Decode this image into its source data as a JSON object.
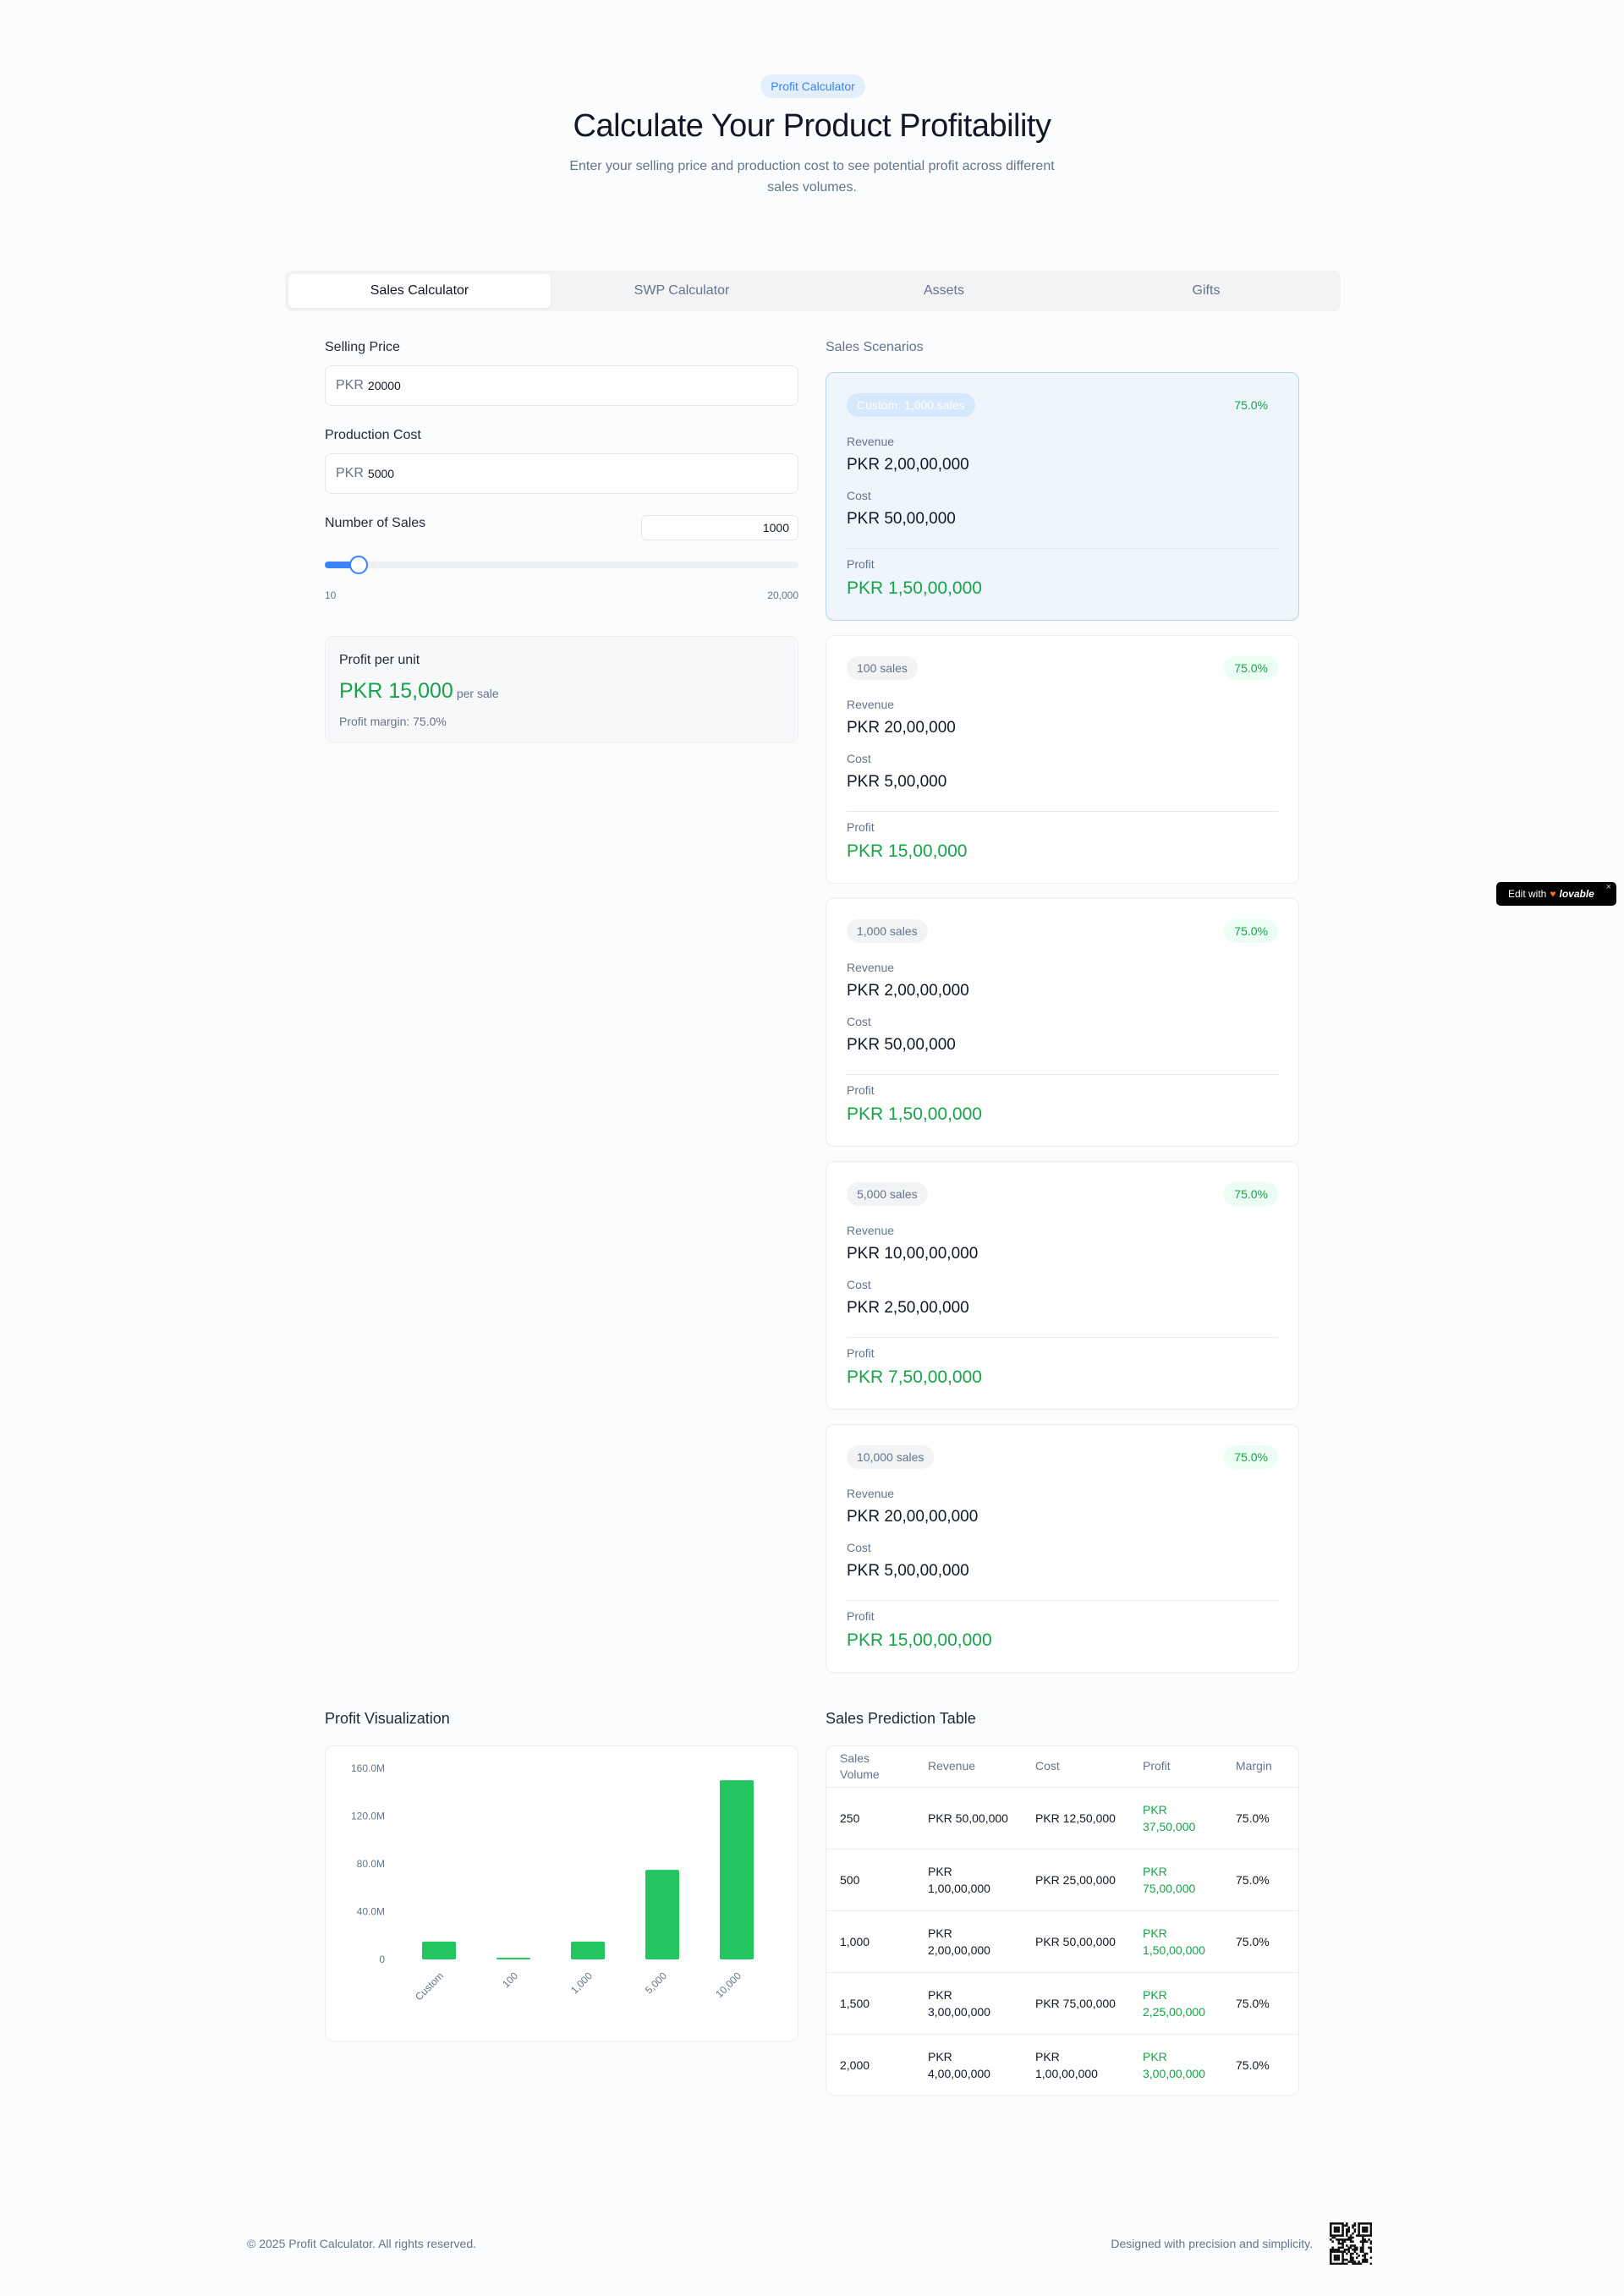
{
  "hero": {
    "badge": "Profit Calculator",
    "title": "Calculate Your Product Profitability",
    "subtitle": "Enter your selling price and production cost to see potential profit across different sales volumes."
  },
  "tabs": [
    {
      "label": "Sales Calculator",
      "active": true
    },
    {
      "label": "SWP Calculator",
      "active": false
    },
    {
      "label": "Assets",
      "active": false
    },
    {
      "label": "Gifts",
      "active": false
    }
  ],
  "form": {
    "selling_price_label": "Selling Price",
    "selling_price_prefix": "PKR",
    "selling_price_value": "20000",
    "production_cost_label": "Production Cost",
    "production_cost_prefix": "PKR",
    "production_cost_value": "5000",
    "sales_label": "Number of Sales",
    "sales_value": "1000",
    "slider_min": "10",
    "slider_max": "20,000",
    "slider_fraction": 0.05
  },
  "profit_per_unit": {
    "title": "Profit per unit",
    "value": "PKR 15,000",
    "per": "per sale",
    "margin": "Profit margin: 75.0%"
  },
  "scenarios": {
    "title": "Sales Scenarios",
    "revenue_label": "Revenue",
    "cost_label": "Cost",
    "profit_label": "Profit",
    "cards": [
      {
        "badge": "Custom: 1,000 sales",
        "margin": "75.0%",
        "revenue": "PKR 2,00,00,000",
        "cost": "PKR 50,00,000",
        "profit": "PKR 1,50,00,000",
        "highlight": true
      },
      {
        "badge": "100 sales",
        "margin": "75.0%",
        "revenue": "PKR 20,00,000",
        "cost": "PKR 5,00,000",
        "profit": "PKR 15,00,000",
        "highlight": false
      },
      {
        "badge": "1,000 sales",
        "margin": "75.0%",
        "revenue": "PKR 2,00,00,000",
        "cost": "PKR 50,00,000",
        "profit": "PKR 1,50,00,000",
        "highlight": false
      },
      {
        "badge": "5,000 sales",
        "margin": "75.0%",
        "revenue": "PKR 10,00,00,000",
        "cost": "PKR 2,50,00,000",
        "profit": "PKR 7,50,00,000",
        "highlight": false
      },
      {
        "badge": "10,000 sales",
        "margin": "75.0%",
        "revenue": "PKR 20,00,00,000",
        "cost": "PKR 5,00,00,000",
        "profit": "PKR 15,00,00,000",
        "highlight": false
      }
    ]
  },
  "visualization": {
    "title": "Profit Visualization"
  },
  "chart_data": {
    "type": "bar",
    "categories": [
      "Custom",
      "100",
      "1,000",
      "5,000",
      "10,000"
    ],
    "values": [
      15000000,
      1500000,
      15000000,
      75000000,
      150000000
    ],
    "ylim": [
      0,
      160000000
    ],
    "yticks": [
      0,
      40000000,
      80000000,
      120000000,
      160000000
    ],
    "ytick_labels": [
      "0",
      "40.0M",
      "80.0M",
      "120.0M",
      "160.0M"
    ],
    "bar_color": "#22c55e",
    "grid": false
  },
  "prediction_table": {
    "title": "Sales Prediction Table",
    "headers": [
      "Sales Volume",
      "Revenue",
      "Cost",
      "Profit",
      "Margin"
    ],
    "rows": [
      [
        "250",
        "PKR 50,00,000",
        "PKR 12,50,000",
        "PKR 37,50,000",
        "75.0%"
      ],
      [
        "500",
        "PKR 1,00,00,000",
        "PKR 25,00,000",
        "PKR 75,00,000",
        "75.0%"
      ],
      [
        "1,000",
        "PKR 2,00,00,000",
        "PKR 50,00,000",
        "PKR 1,50,00,000",
        "75.0%"
      ],
      [
        "1,500",
        "PKR 3,00,00,000",
        "PKR 75,00,000",
        "PKR 2,25,00,000",
        "75.0%"
      ],
      [
        "2,000",
        "PKR 4,00,00,000",
        "PKR 1,00,00,000",
        "PKR 3,00,00,000",
        "75.0%"
      ]
    ]
  },
  "footer": {
    "copyright": "© 2025 Profit Calculator. All rights reserved.",
    "tagline": "Designed with precision and simplicity."
  },
  "edit_badge": {
    "prefix": "Edit with",
    "brand": "lovable",
    "close": "×"
  },
  "colors": {
    "accent": "#3b82f6",
    "profit": "#16a34a",
    "bar": "#22c55e"
  }
}
